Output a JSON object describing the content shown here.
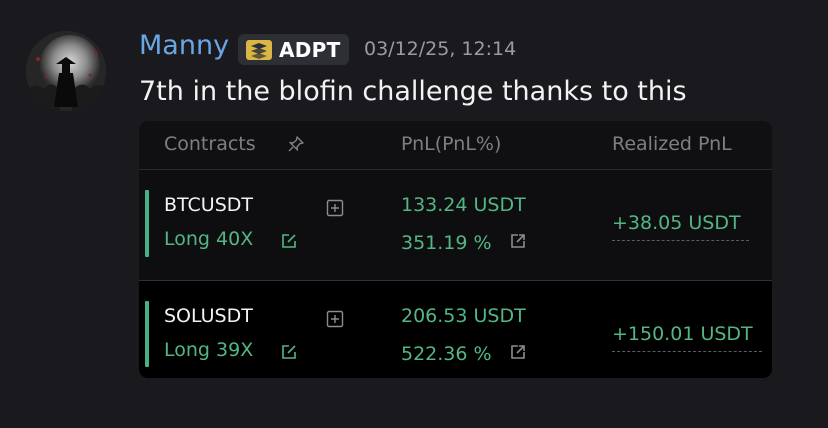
{
  "message": {
    "username": "Manny",
    "tag": "ADPT",
    "timestamp": "03/12/25, 12:14",
    "text": "7th in the blofin challenge thanks to this"
  },
  "table": {
    "headers": {
      "contracts": "Contracts",
      "pnl": "PnL(PnL%)",
      "realized": "Realized PnL"
    },
    "rows": [
      {
        "symbol": "BTCUSDT",
        "leverage": "Long 40X",
        "pnl_usdt": "133.24 USDT",
        "pnl_pct": "351.19 %",
        "realized": "+38.05 USDT"
      },
      {
        "symbol": "SOLUSDT",
        "leverage": "Long 39X",
        "pnl_usdt": "206.53 USDT",
        "pnl_pct": "522.36 %",
        "realized": "+150.01 USDT"
      }
    ]
  },
  "colors": {
    "username": "#6aa6e6",
    "positive": "#53b684",
    "background": "#1a1a1e"
  },
  "icons": [
    "avatar-image",
    "server-tag-icon",
    "pin-icon",
    "add-box-icon",
    "edit-icon",
    "share-icon"
  ]
}
